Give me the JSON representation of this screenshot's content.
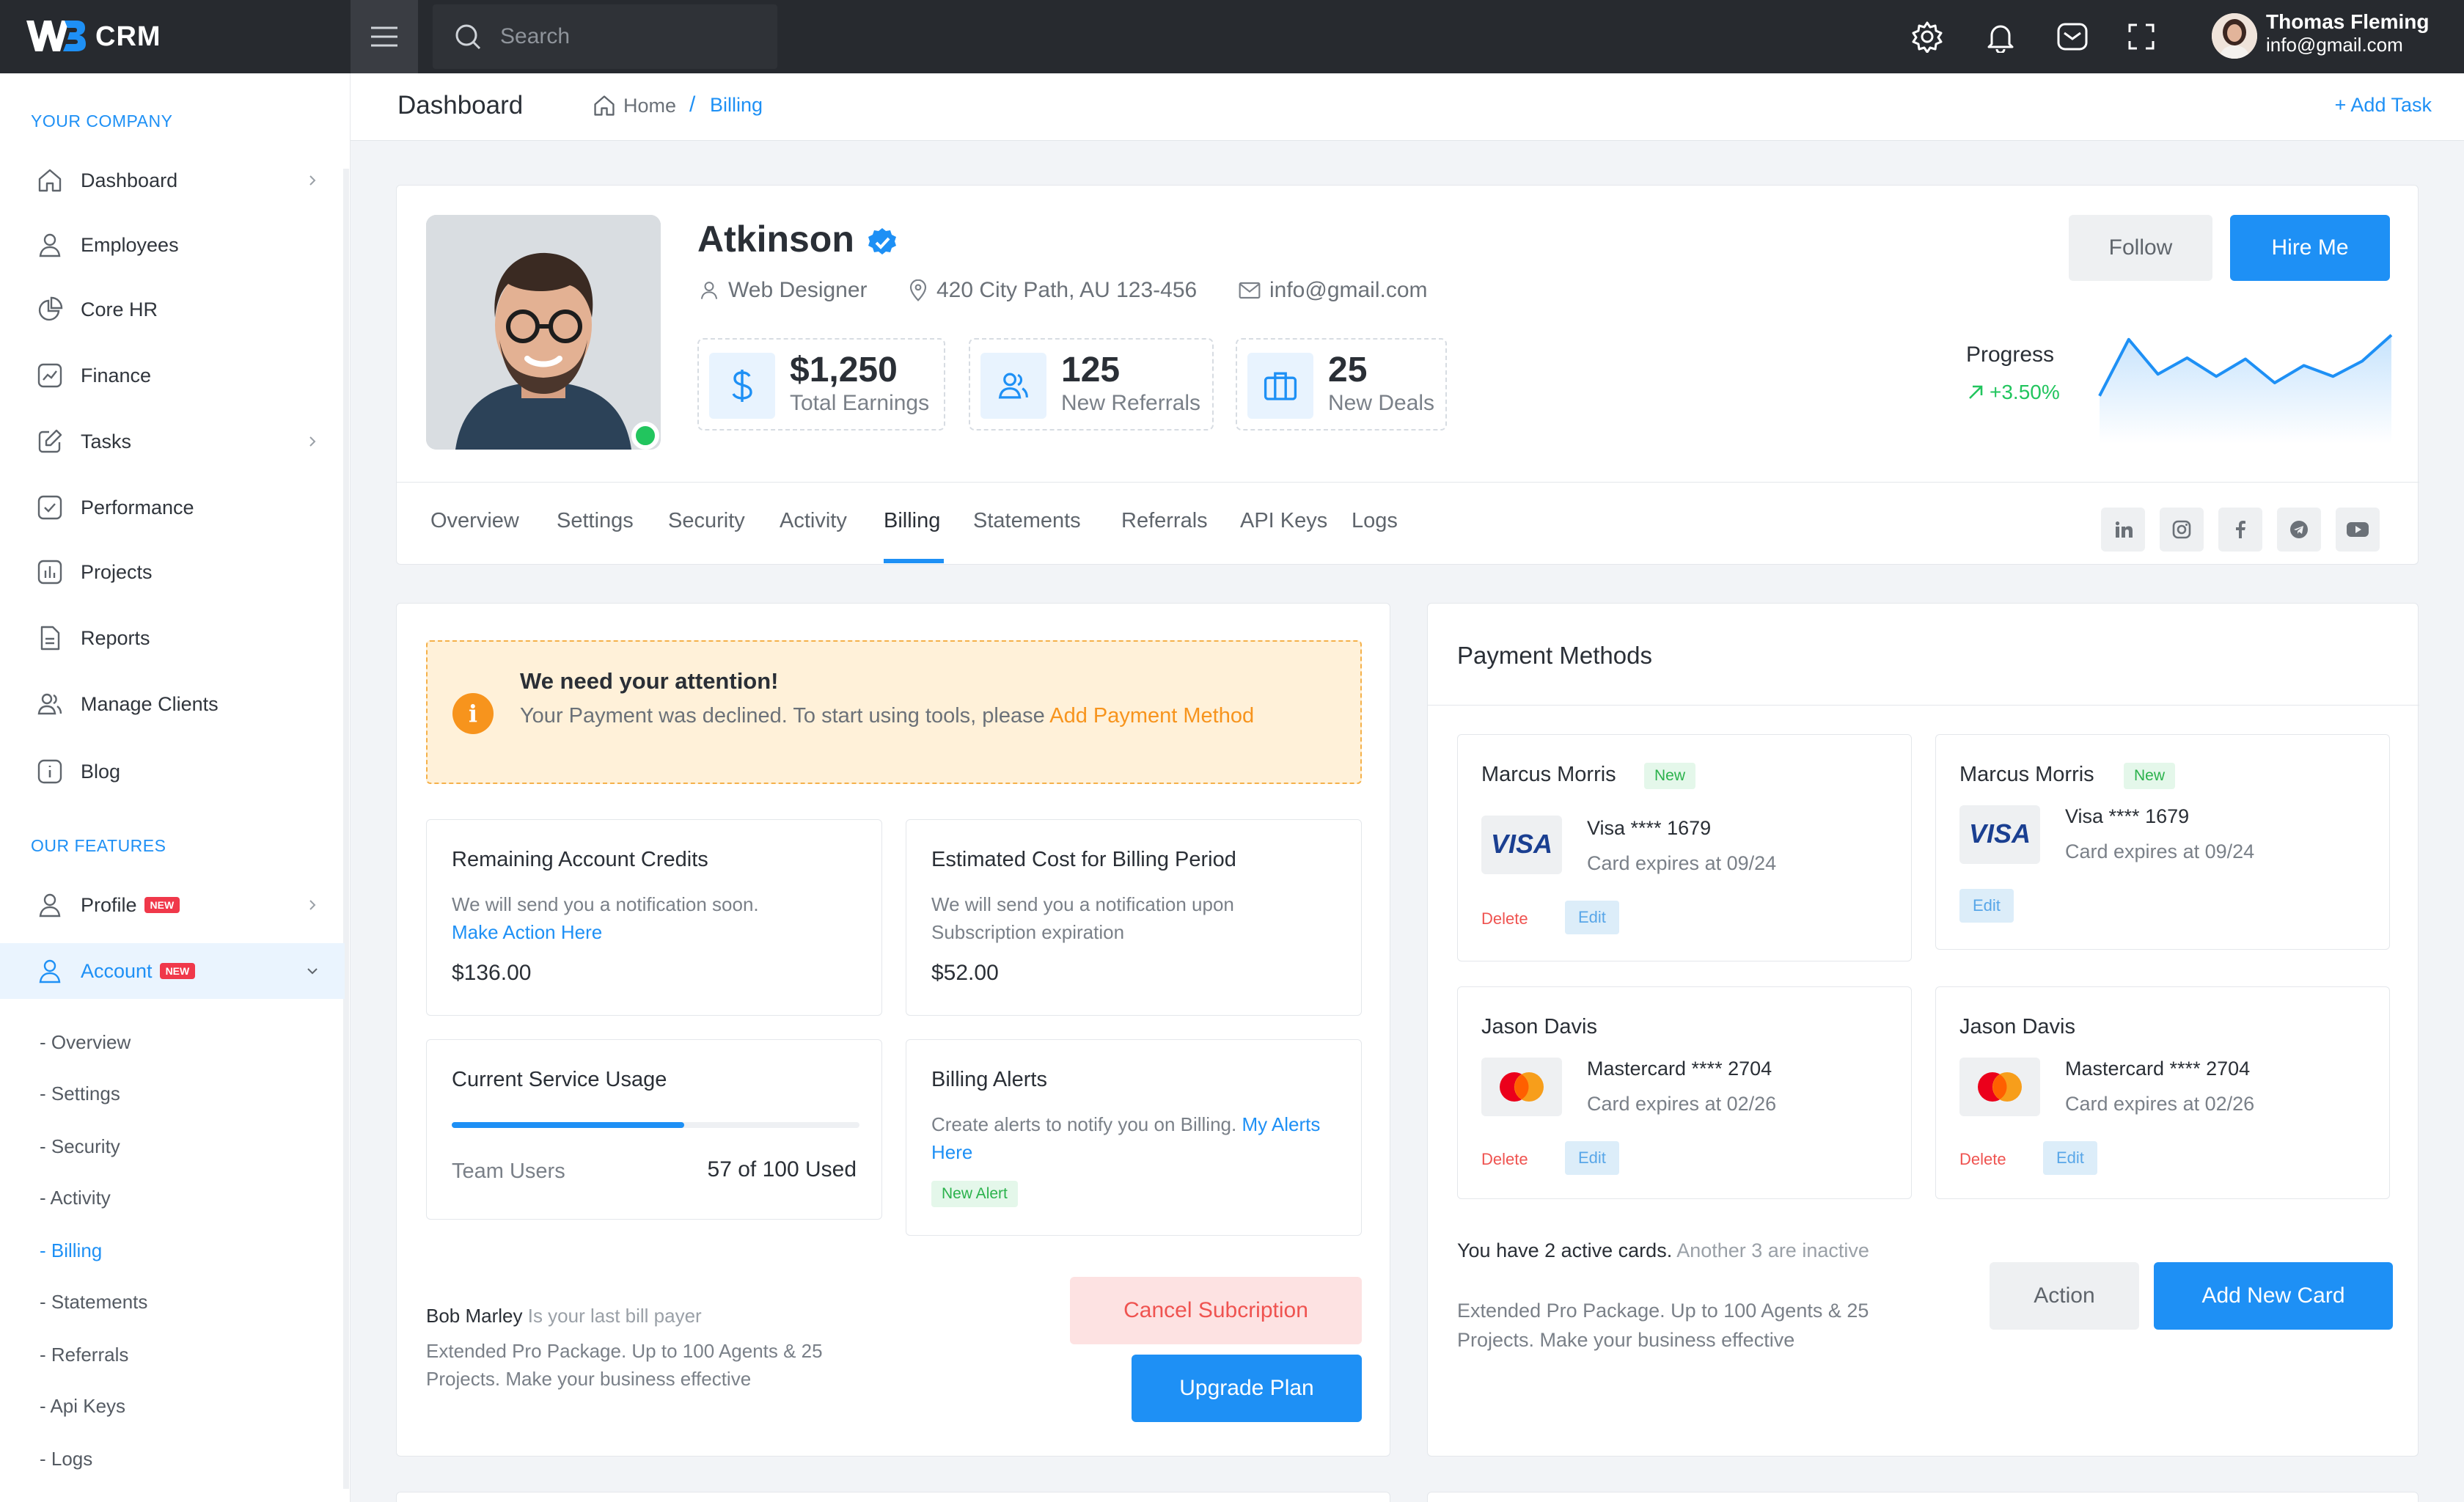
{
  "app": {
    "logo_text": "CRM",
    "accent": "#1e90f5"
  },
  "topbar": {
    "search_placeholder": "Search",
    "user": {
      "name": "Thomas Fleming",
      "email": "info@gmail.com"
    },
    "icons": [
      "settings-icon",
      "bell-icon",
      "mail-icon",
      "fullscreen-icon"
    ]
  },
  "sidebar": {
    "section1": "YOUR COMPANY",
    "section2": "OUR FEATURES",
    "items": [
      {
        "label": "Dashboard",
        "icon": "home-icon"
      },
      {
        "label": "Employees",
        "icon": "user-icon"
      },
      {
        "label": "Core HR",
        "icon": "pie-icon"
      },
      {
        "label": "Finance",
        "icon": "chart-icon"
      },
      {
        "label": "Tasks",
        "icon": "edit-icon"
      },
      {
        "label": "Performance",
        "icon": "check-icon"
      },
      {
        "label": "Projects",
        "icon": "bar-chart-icon"
      },
      {
        "label": "Reports",
        "icon": "file-icon"
      },
      {
        "label": "Manage Clients",
        "icon": "users-icon"
      },
      {
        "label": "Blog",
        "icon": "info-icon"
      }
    ],
    "features": [
      {
        "label": "Profile",
        "badge": "NEW"
      },
      {
        "label": "Account",
        "badge": "NEW"
      }
    ],
    "sub": [
      "- Overview",
      "- Settings",
      "- Security",
      "- Activity",
      "- Billing",
      "- Statements",
      "- Referrals",
      "- Api Keys",
      "- Logs"
    ]
  },
  "breadcrumb": {
    "title": "Dashboard",
    "home": "Home",
    "sep": "/",
    "current": "Billing",
    "add_task": "+ Add Task"
  },
  "profile": {
    "name": "Atkinson",
    "role": "Web Designer",
    "address": "420 City Path, AU 123-456",
    "email": "info@gmail.com",
    "stats": [
      {
        "value": "$1,250",
        "label": "Total Earnings"
      },
      {
        "value": "125",
        "label": "New Referrals"
      },
      {
        "value": "25",
        "label": "New Deals"
      }
    ],
    "follow": "Follow",
    "hire": "Hire Me",
    "progress_label": "Progress",
    "progress_value": "+3.50%",
    "progress_series": [
      40,
      92,
      60,
      75,
      58,
      74,
      52,
      68,
      58,
      72,
      96
    ]
  },
  "tabs": [
    "Overview",
    "Settings",
    "Security",
    "Activity",
    "Billing",
    "Statements",
    "Referrals",
    "API Keys",
    "Logs"
  ],
  "socials": [
    "linkedin-icon",
    "instagram-icon",
    "facebook-icon",
    "telegram-icon",
    "youtube-icon"
  ],
  "billing": {
    "attention_title": "We need your attention!",
    "attention_text": "Your Payment was declined. To start using tools, please",
    "attention_link": "Add Payment Method",
    "credits": {
      "title": "Remaining Account Credits",
      "text": "We will send you a notification soon.",
      "link": "Make Action Here",
      "value": "$136.00"
    },
    "estimate": {
      "title": "Estimated Cost for Billing Period",
      "text": "We will send you a notification upon Subscription expiration",
      "value": "$52.00"
    },
    "usage": {
      "title": "Current Service Usage",
      "label": "Team Users",
      "value": "57 of 100 Used",
      "fraction": 0.57
    },
    "alerts": {
      "title": "Billing Alerts",
      "text": "Create alerts to notify you on Billing.",
      "link": "My Alerts Here",
      "pill": "New Alert"
    },
    "payer_name": "Bob Marley",
    "payer_text": "Is your last bill payer",
    "payer_desc": "Extended Pro Package. Up to 100 Agents & 25 Projects. Make your business effective",
    "cancel": "Cancel Subcription",
    "upgrade": "Upgrade Plan"
  },
  "payment": {
    "title": "Payment Methods",
    "cards": [
      {
        "name": "Marcus Morris",
        "badge": "New",
        "number": "Visa **** 1679",
        "expires": "Card expires at 09/24",
        "delete": "Delete",
        "edit": "Edit"
      },
      {
        "name": "Marcus Morris",
        "badge": "New",
        "number": "Visa **** 1679",
        "expires": "Card expires at 09/24",
        "edit": "Edit"
      },
      {
        "name": "Jason Davis",
        "number": "Mastercard **** 2704",
        "expires": "Card expires at 02/26",
        "delete": "Delete",
        "edit": "Edit"
      },
      {
        "name": "Jason Davis",
        "number": "Mastercard **** 2704",
        "expires": "Card expires at 02/26",
        "delete": "Delete",
        "edit": "Edit"
      }
    ],
    "active_strong": "You have 2 active cards.",
    "active_rest": "Another 3 are inactive",
    "package": "Extended Pro Package. Up to 100 Agents & 25 Projects. Make your business effective",
    "action": "Action",
    "add_card": "Add New Card"
  }
}
